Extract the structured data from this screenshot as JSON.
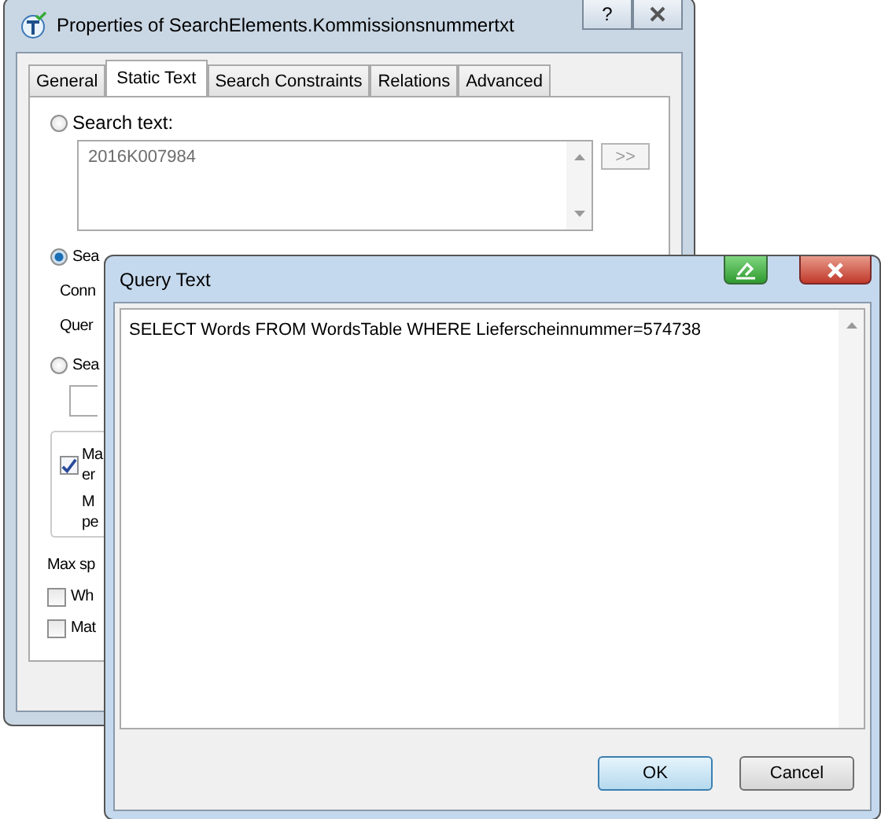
{
  "properties_dialog": {
    "title": "Properties of SearchElements.Kommissionsnummertxt",
    "help_button": "?",
    "tabs": [
      {
        "label": "General",
        "selected": false
      },
      {
        "label": "Static Text",
        "selected": true
      },
      {
        "label": "Search Constraints",
        "selected": false
      },
      {
        "label": "Relations",
        "selected": false
      },
      {
        "label": "Advanced",
        "selected": false
      }
    ],
    "search_text_option": {
      "label": "Search text:",
      "selected": false
    },
    "search_text_value": "2016K007984",
    "insert_button": {
      "label": ">>",
      "disabled": true
    },
    "database_option": {
      "label": "Sea",
      "selected": true
    },
    "connection_label": "Conn",
    "query_label": "Quer",
    "third_option": {
      "label": "Sea",
      "selected": false
    },
    "group_checkbox": {
      "lines": [
        "Ma",
        "er"
      ],
      "checked": true
    },
    "group_note": [
      "M",
      "pe"
    ],
    "max_label": "Max sp",
    "checkboxes": [
      {
        "label": "Wh",
        "checked": false
      },
      {
        "label": "Mat",
        "checked": false
      }
    ]
  },
  "query_window": {
    "title": "Query Text",
    "query": "SELECT Words FROM WordsTable WHERE Lieferscheinnummer=574738",
    "buttons": [
      {
        "label": "OK",
        "default": true
      },
      {
        "label": "Cancel",
        "default": false
      }
    ]
  }
}
